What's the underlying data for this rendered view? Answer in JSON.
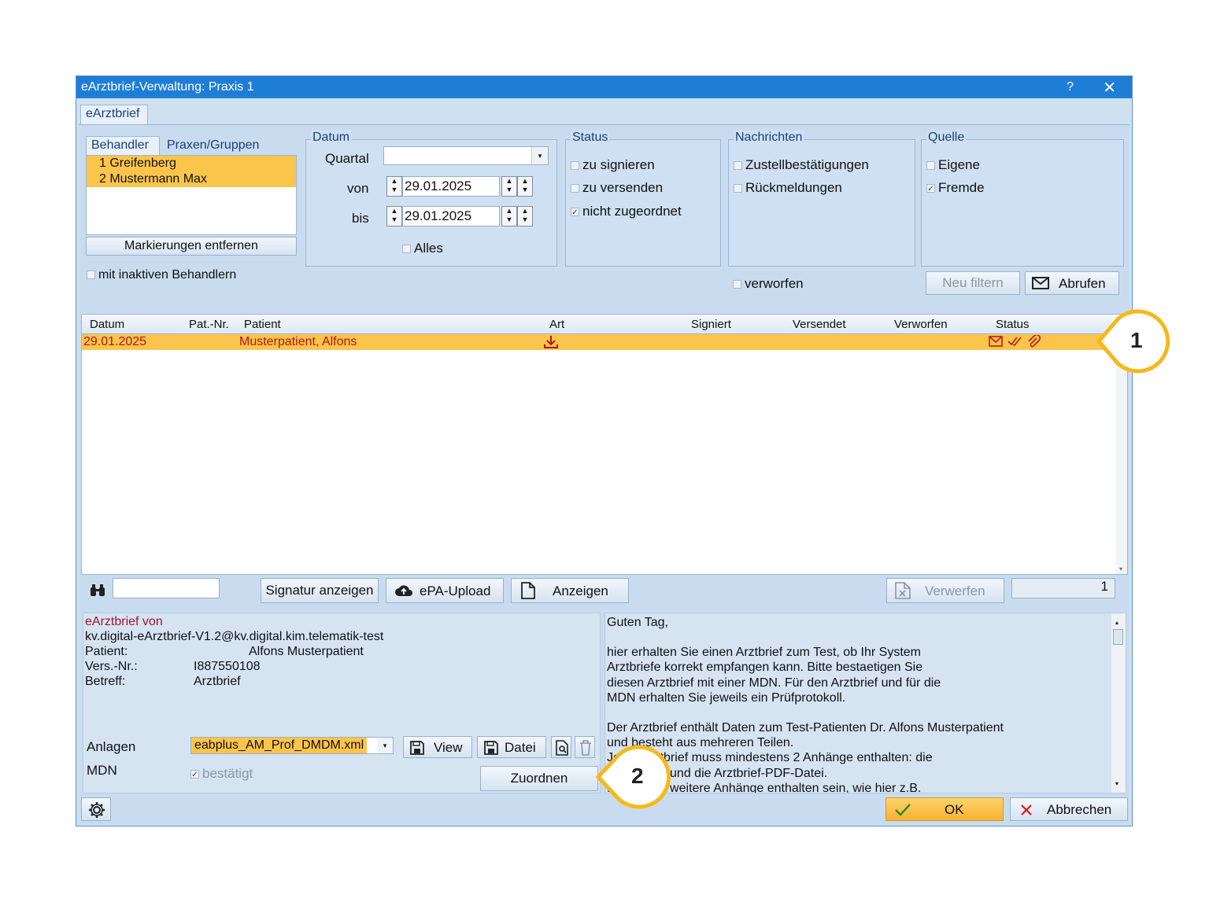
{
  "window": {
    "title": "eArztbrief-Verwaltung: Praxis 1",
    "help": "?",
    "close": "✕"
  },
  "main_tab": "eArztbrief",
  "left_tabs": [
    "Behandler",
    "Praxen/Gruppen"
  ],
  "behandler": [
    "1 Greifenberg",
    "2 Mustermann Max"
  ],
  "markierungen_btn": "Markierungen entfernen",
  "inaktive_label": "mit inaktiven Behandlern",
  "datum": {
    "legend": "Datum",
    "quartal_label": "Quartal",
    "quartal_value": "",
    "von_label": "von",
    "von_value": "29.01.2025",
    "bis_label": "bis",
    "bis_value": "29.01.2025",
    "alles_label": "Alles"
  },
  "status": {
    "legend": "Status",
    "items": [
      {
        "label": "zu signieren",
        "checked": false
      },
      {
        "label": "zu versenden",
        "checked": false
      },
      {
        "label": "nicht zugeordnet",
        "checked": true
      }
    ]
  },
  "nachrichten": {
    "legend": "Nachrichten",
    "items": [
      {
        "label": "Zustellbestätigungen",
        "checked": false
      },
      {
        "label": "Rückmeldungen",
        "checked": false
      }
    ],
    "verworfen_label": "verworfen"
  },
  "quelle": {
    "legend": "Quelle",
    "items": [
      {
        "label": "Eigene",
        "checked": false
      },
      {
        "label": "Fremde",
        "checked": true
      }
    ]
  },
  "neu_filtern_btn": "Neu filtern",
  "abrufen_btn": "Abrufen",
  "table": {
    "columns": [
      "Datum",
      "Pat.-Nr.",
      "Patient",
      "Art",
      "Signiert",
      "Versendet",
      "Verworfen",
      "Status"
    ],
    "rows": [
      {
        "datum": "29.01.2025",
        "patnr": "",
        "patient": "Musterpatient, Alfons"
      }
    ]
  },
  "toolbar": {
    "search_value": "",
    "signatur_btn": "Signatur anzeigen",
    "epa_btn": "ePA-Upload",
    "anzeigen_btn": "Anzeigen",
    "verwerfen_btn": "Verwerfen",
    "count": "1"
  },
  "detail": {
    "header": "eArztbrief von",
    "sender": "kv.digital-eArztbrief-V1.2@kv.digital.kim.telematik-test",
    "patient_label": "Patient:",
    "patient_value": "Alfons Musterpatient",
    "vers_label": "Vers.-Nr.:",
    "vers_value": "I887550108",
    "betreff_label": "Betreff:",
    "betreff_value": "Arztbrief",
    "anlagen_label": "Anlagen",
    "anlagen_value": "eabplus_AM_Prof_DMDM.xml",
    "view_btn": "View",
    "datei_btn": "Datei",
    "mdn_label": "MDN",
    "mdn_value": "bestätigt",
    "zuordnen_btn": "Zuordnen"
  },
  "message": {
    "l1": "Guten Tag,",
    "l2": "hier erhalten Sie einen Arztbrief zum Test, ob Ihr System",
    "l3": "Arztbriefe korrekt empfangen kann. Bitte bestaetigen Sie",
    "l4": "diesen Arztbrief mit einer MDN. Für den Arztbrief und für die",
    "l5": "MDN erhalten Sie jeweils ein Prüfprotokoll.",
    "l6": "Der Arztbrief enthält Daten zum Test-Patienten Dr. Alfons Musterpatient",
    "l7": "und besteht aus mehreren Teilen.",
    "l8": "Jeder Arztbrief muss mindestens 2 Anhänge enthalten: die",
    "l9": "XML-Datei und die Arztbrief-PDF-Datei.",
    "l10": "Es können weitere Anhänge enthalten sein, wie hier z.B."
  },
  "footer": {
    "ok_btn": "OK",
    "abbrechen_btn": "Abbrechen"
  },
  "callouts": [
    "1",
    "2"
  ],
  "colors": {
    "titlebar": "#1e7ed6",
    "highlight": "#fbc54b",
    "red_text": "#b4141e",
    "callout_ring": "#f6b91a"
  }
}
